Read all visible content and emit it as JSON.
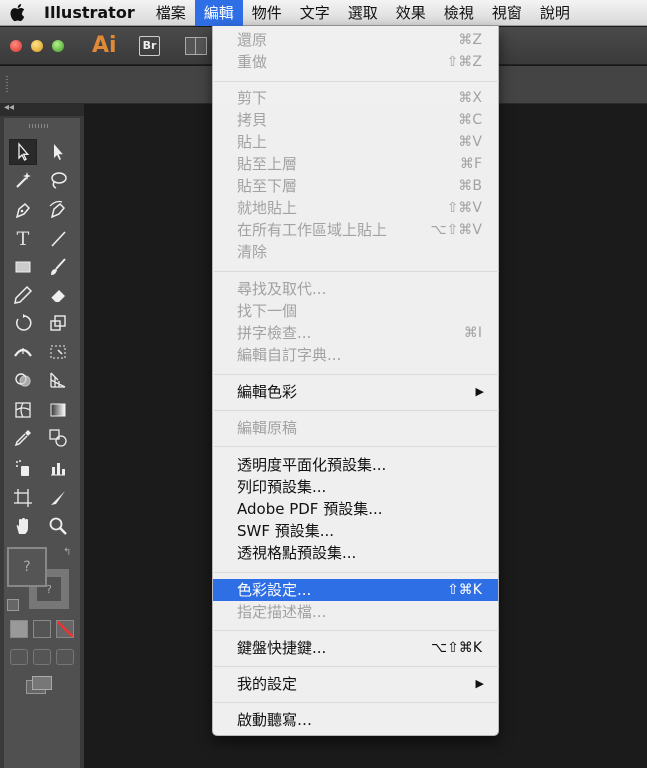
{
  "menubar": {
    "app_name": "Illustrator",
    "items": [
      "檔案",
      "編輯",
      "物件",
      "文字",
      "選取",
      "效果",
      "檢視",
      "視窗",
      "說明"
    ]
  },
  "titlebar": {
    "app_logo": "Ai",
    "bridge_badge": "Br"
  },
  "edit_menu": {
    "undo": {
      "label": "還原",
      "shortcut": "⌘Z"
    },
    "redo": {
      "label": "重做",
      "shortcut": "⇧⌘Z"
    },
    "cut": {
      "label": "剪下",
      "shortcut": "⌘X"
    },
    "copy": {
      "label": "拷貝",
      "shortcut": "⌘C"
    },
    "paste": {
      "label": "貼上",
      "shortcut": "⌘V"
    },
    "paste_front": {
      "label": "貼至上層",
      "shortcut": "⌘F"
    },
    "paste_back": {
      "label": "貼至下層",
      "shortcut": "⌘B"
    },
    "paste_in_place": {
      "label": "就地貼上",
      "shortcut": "⇧⌘V"
    },
    "paste_all_artboards": {
      "label": "在所有工作區域上貼上",
      "shortcut": "⌥⇧⌘V"
    },
    "clear": {
      "label": "清除"
    },
    "find_replace": {
      "label": "尋找及取代..."
    },
    "find_next": {
      "label": "找下一個"
    },
    "spelling": {
      "label": "拼字檢查...",
      "shortcut": "⌘I"
    },
    "edit_dictionary": {
      "label": "編輯自訂字典..."
    },
    "edit_colors": {
      "label": "編輯色彩"
    },
    "edit_original": {
      "label": "編輯原稿"
    },
    "transparency_flattener": {
      "label": "透明度平面化預設集..."
    },
    "print_presets": {
      "label": "列印預設集..."
    },
    "pdf_presets": {
      "label": "Adobe PDF 預設集..."
    },
    "swf_presets": {
      "label": "SWF 預設集..."
    },
    "perspective_presets": {
      "label": "透視格點預設集..."
    },
    "color_settings": {
      "label": "色彩設定...",
      "shortcut": "⇧⌘K"
    },
    "assign_profile": {
      "label": "指定描述檔..."
    },
    "keyboard_shortcuts": {
      "label": "鍵盤快捷鍵...",
      "shortcut": "⌥⇧⌘K"
    },
    "preferences": {
      "label": "我的設定"
    },
    "start_dictation": {
      "label": "啟動聽寫…"
    }
  },
  "toolbox": {
    "type_tool_glyph": "T",
    "unknown_fill": "?",
    "unknown_stroke": "?",
    "swap_glyph": "↰"
  },
  "colors": {
    "menu_highlight": "#2f6fe6",
    "menu_disabled_text": "#a2a2a2",
    "app_logo": "#e08a38"
  }
}
